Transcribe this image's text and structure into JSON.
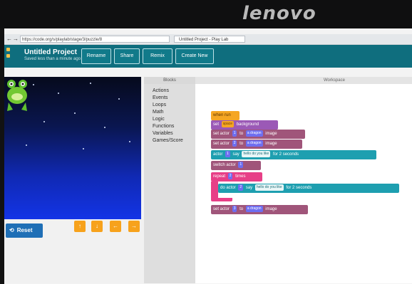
{
  "bezel": {
    "brand": "lenovo"
  },
  "browser": {
    "address": "https://code.org/s/playlab/stage/3/puzzle/8",
    "tab_title": "Untitled Project - Play Lab"
  },
  "appbar": {
    "title": "Untitled Project",
    "subtitle": "Saved less than a minute ago",
    "buttons": [
      "Rename",
      "Share",
      "Remix",
      "Create New"
    ]
  },
  "controls": {
    "reset_label": "Reset",
    "yellow_buttons": [
      "↑",
      "↓",
      "←",
      "→"
    ]
  },
  "toolbox": {
    "header": "Blocks",
    "categories": [
      "Actions",
      "Events",
      "Loops",
      "Math",
      "Logic",
      "Functions",
      "Variables",
      "Games/Score"
    ]
  },
  "workspace": {
    "header": "Workspace",
    "blocks": [
      {
        "text": "when run",
        "color": "#f5a623"
      },
      {
        "prefix": "set",
        "chip": "space",
        "suffix": "background",
        "color": "#9b59b6"
      },
      {
        "prefix": "set actor",
        "chip": "1",
        "mid": "to",
        "chip2": "a dragon",
        "suffix": "image",
        "color": "#a0557a"
      },
      {
        "prefix": "set actor",
        "chip": "2",
        "mid": "to",
        "chip2": "a dragon",
        "suffix": "image",
        "color": "#a0557a"
      },
      {
        "prefix": "actor",
        "chip": "1",
        "mid": "say",
        "chip2": "hello do you like",
        "suffix": "for 2 seconds",
        "color": "#1e9fb0"
      },
      {
        "prefix": "switch actor",
        "chip": "1",
        "color": "#a0557a"
      },
      {
        "prefix": "repeat",
        "chip": "2",
        "suffix": "times",
        "color": "#e73f87"
      },
      {
        "prefix": "do actor",
        "chip": "2",
        "mid": "say",
        "chip2": "hello do you like",
        "suffix": "for 2 seconds",
        "color": "#1e9fb0"
      },
      {
        "prefix": "set actor",
        "chip": "3",
        "mid": "to",
        "chip2": "a dragon",
        "suffix": "image",
        "color": "#a0557a"
      }
    ]
  }
}
